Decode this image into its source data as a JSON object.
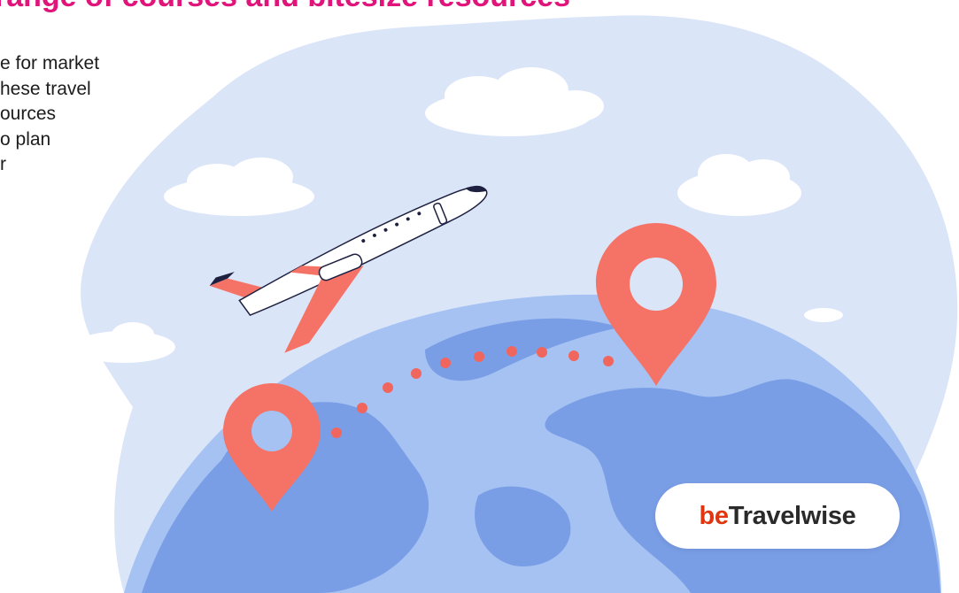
{
  "heading": "range of courses and bitesize resources",
  "body_lines": [
    "e for market",
    "hese travel",
    "ources",
    "o plan",
    "r"
  ],
  "logo": {
    "prefix": "be",
    "rest": "Travelwise"
  },
  "colors": {
    "heading": "#e0147a",
    "logo_prefix": "#e0360f",
    "sky_blob": "#dbe5f8",
    "globe": "#a5c2f2",
    "land": "#7a9ee6",
    "pin": "#f47266",
    "route_dots": "#f0665f"
  },
  "icons": [
    "airplane-icon",
    "map-pin-icon",
    "cloud-icon"
  ]
}
